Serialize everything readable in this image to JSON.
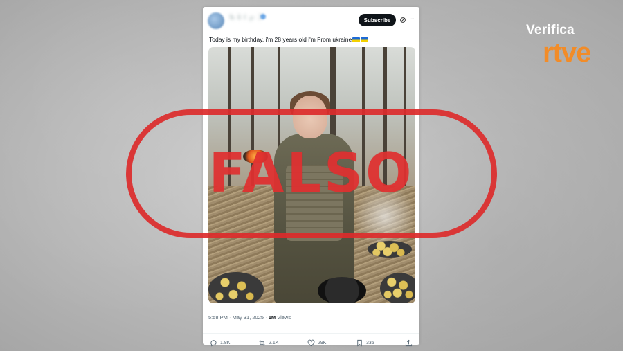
{
  "post": {
    "author_name": "Ѣ ℹ ℓ ℘ ℑ",
    "subscribe_label": "Subscribe",
    "more_label": "···",
    "text": "Today is my birthday, i'm 28 years old i'm From ukraine",
    "flags": [
      "ukraine-flag-icon",
      "ukraine-flag-icon"
    ],
    "timestamp": "5:58 PM · May 31, 2025 · ",
    "views_count": "1M",
    "views_label": " Views",
    "actions": {
      "replies": "1.8K",
      "reposts": "2.1K",
      "likes": "29K",
      "bookmarks": "335"
    }
  },
  "stamp": {
    "label": "FALSO",
    "color": "#dc2b2b"
  },
  "brand": {
    "verifica": "Verifica",
    "rtve": "rtve",
    "rtve_color": "#f28c28"
  },
  "colors": {
    "card_bg": "#ffffff",
    "subscribe_bg": "#0f1419",
    "muted": "#536471"
  }
}
